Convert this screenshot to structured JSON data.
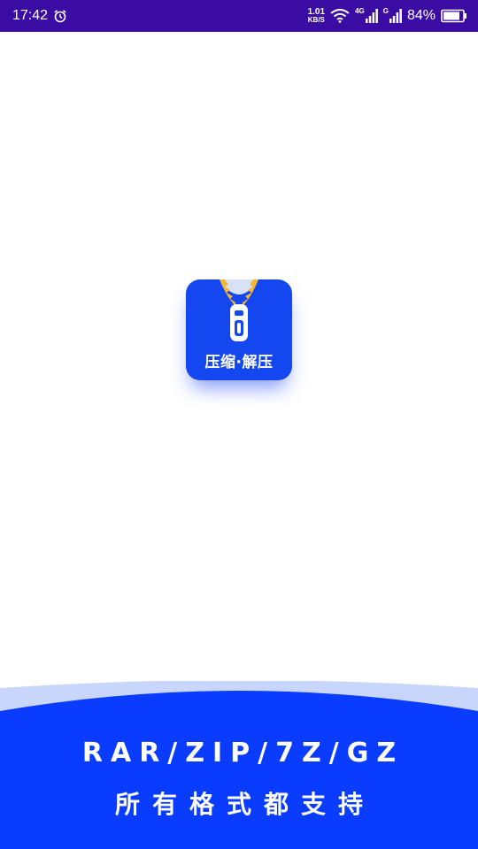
{
  "status_bar": {
    "time": "17:42",
    "net_speed_value": "1.01",
    "net_speed_unit": "KB/S",
    "signal1_tag": "4G",
    "signal2_tag": "G",
    "battery_percent": "84%",
    "background_color": "#3a0ca3"
  },
  "app_icon": {
    "label": "压缩·解压",
    "background_color": "#1547f0",
    "zipper_color": "#f2b632"
  },
  "banner": {
    "formats": "RAR/ZIP/7Z/GZ",
    "tagline": "所有格式都支持",
    "primary_color": "#0a3cff",
    "light_color": "#c9d6fb"
  }
}
